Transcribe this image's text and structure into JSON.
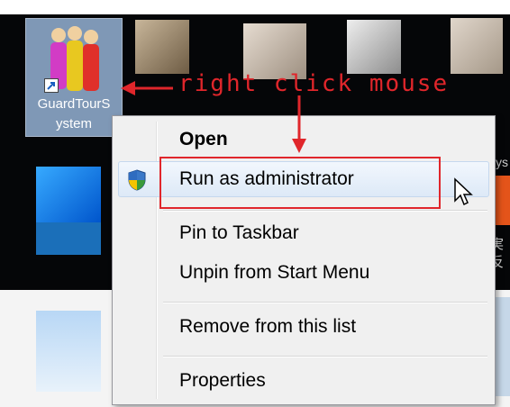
{
  "desktop_icon": {
    "label_line1": "GuardTourS",
    "label_line2": "ystem"
  },
  "annotation": {
    "text": "right click mouse"
  },
  "context_menu": {
    "items": [
      {
        "label": "Open"
      },
      {
        "label": "Run as administrator"
      },
      {
        "label": "Pin to Taskbar"
      },
      {
        "label": "Unpin from Start Menu"
      },
      {
        "label": "Remove from this list"
      },
      {
        "label": "Properties"
      }
    ]
  },
  "side_text": {
    "right_top": "ys",
    "right_mid": "実\n反"
  },
  "colors": {
    "annotation_red": "#e0262b",
    "menu_bg": "#f0f0f0",
    "icon_bg": "#7f98b6"
  }
}
